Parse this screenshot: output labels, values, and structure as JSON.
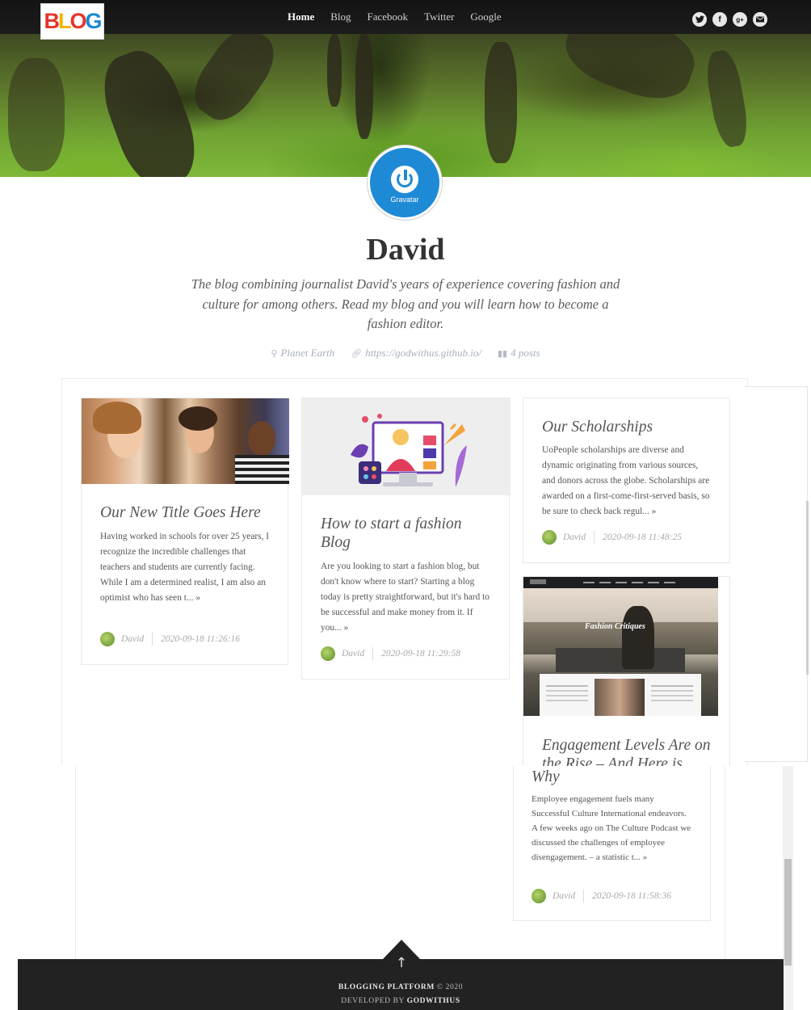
{
  "logo": {
    "letters": [
      "B",
      "L",
      "O",
      "G"
    ],
    "colors": [
      "#e5332a",
      "#f4b400",
      "#e8332a",
      "#1a8ad4"
    ]
  },
  "nav": {
    "items": [
      {
        "label": "Home",
        "active": true
      },
      {
        "label": "Blog",
        "active": false
      },
      {
        "label": "Facebook",
        "active": false
      },
      {
        "label": "Twitter",
        "active": false
      },
      {
        "label": "Google",
        "active": false
      }
    ],
    "social_icons": [
      "twitter-icon",
      "facebook-icon",
      "google-plus-icon",
      "mail-icon"
    ]
  },
  "profile": {
    "avatar_label": "Gravatar",
    "name": "David",
    "bio": "The blog combining journalist David's years of experience covering fashion and culture for among others. Read my blog and you will learn how to become a fashion editor.",
    "location": "Planet Earth",
    "website": "https://godwithus.github.io/",
    "posts_count": "4 posts"
  },
  "posts": [
    {
      "title": "Our New Title Goes Here",
      "excerpt": "Having worked in schools for over 25 years, I recognize the incredible challenges that teachers and students are currently facing. While I am a determined realist, I am also an optimist who has seen t... »",
      "author": "David",
      "date": "2020-09-18 11:26:16"
    },
    {
      "title": "How to start a fashion Blog",
      "excerpt": "Are you looking to start a fashion blog, but don't know where to start? Starting a blog today is pretty straightforward, but it's hard to be successful and make money from it. If you... »",
      "author": "David",
      "date": "2020-09-18 11:29:58"
    },
    {
      "title": "Our Scholarships",
      "excerpt": "UoPeople scholarships are diverse and dynamic originating from various sources, and donors across the globe. Scholarships are awarded on a first-come-first-served basis, so be sure to check back regul... »",
      "author": "David",
      "date": "2020-09-18 11:48:25"
    },
    {
      "title_top": "Engagement Levels Are on the Rise – And Here is",
      "title_tail": "Why",
      "image_caption": "Fashion Critiques",
      "excerpt": "Employee engagement fuels many Successful Culture International endeavors. A few weeks ago on The Culture Podcast we discussed the challenges of employee disengagement. – a statistic t... »",
      "author": "David",
      "date": "2020-09-18 11:58:36"
    }
  ],
  "footer": {
    "line1_bold": "BLOGGING PLATFORM",
    "line1_rest": "© 2020",
    "line2_prefix": "DEVELOPED BY",
    "line2_bold": "GODWITHUS"
  }
}
